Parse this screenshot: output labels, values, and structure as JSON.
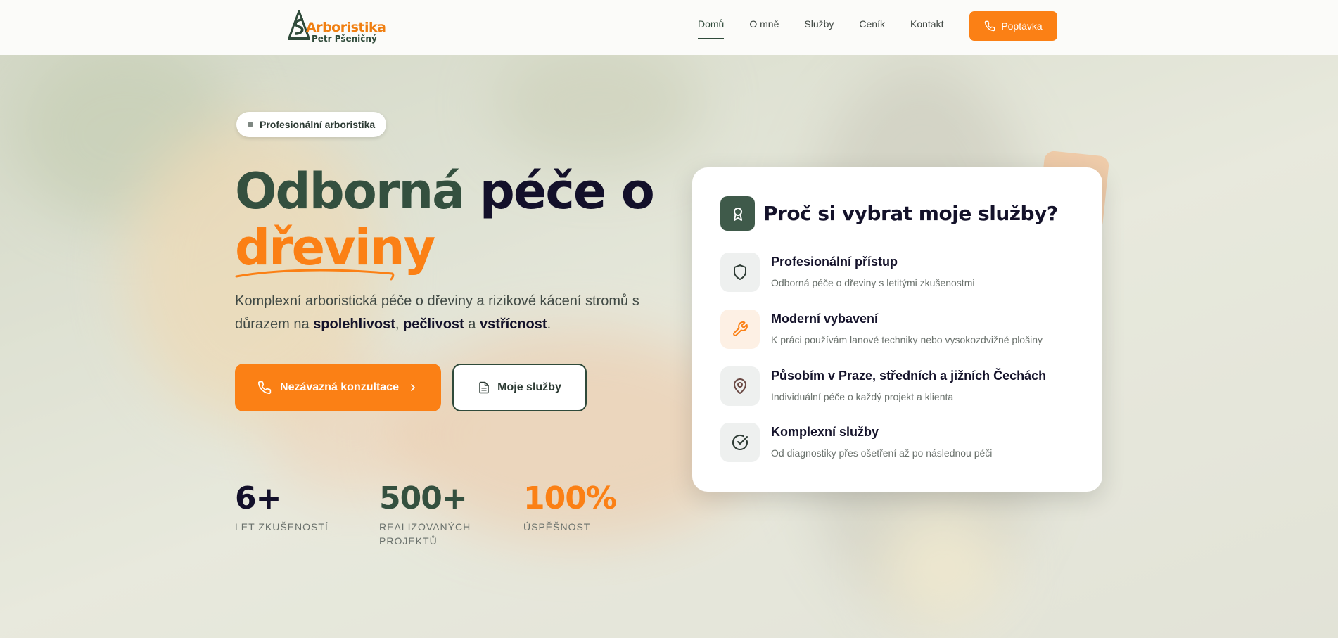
{
  "brand": {
    "title": "Arboristika",
    "subtitle": "Petr Pšeničný",
    "colors": {
      "primary": "#fb8015",
      "dark_green": "#2f4a3a",
      "navy": "#13102a"
    }
  },
  "nav": {
    "items": [
      {
        "label": "Domů",
        "active": true
      },
      {
        "label": "O mně",
        "active": false
      },
      {
        "label": "Služby",
        "active": false
      },
      {
        "label": "Ceník",
        "active": false
      },
      {
        "label": "Kontakt",
        "active": false
      }
    ],
    "cta_label": "Poptávka",
    "cta_icon": "phone-icon"
  },
  "hero": {
    "badge": "Profesionální arboristika",
    "title_part1": "Odborná",
    "title_part2": "péče o",
    "title_part3": "dřeviny",
    "lead_text": "Komplexní arboristická péče o dřeviny a rizikové kácení stromů s důrazem na",
    "lead_bold1": "spolehlivost",
    "lead_sep1": ",",
    "lead_bold2": "pečlivost",
    "lead_sep2": "a",
    "lead_bold3": "vstřícnost",
    "lead_end": ".",
    "primary_button": {
      "label": "Nezávazná konzultace",
      "icon": "phone-icon",
      "trailing_icon": "chevron-right-icon"
    },
    "secondary_button": {
      "label": "Moje služby",
      "icon": "document-icon"
    }
  },
  "stats": [
    {
      "value": "6+",
      "label": "LET ZKUŠENOSTÍ",
      "color": "#13102a"
    },
    {
      "value": "500+",
      "label_line1": "REALIZOVANÝCH",
      "label_line2": "PROJEKTŮ",
      "color": "#34503f"
    },
    {
      "value": "100%",
      "label": "ÚSPĚŠNOST",
      "color": "#fb8015"
    }
  ],
  "card": {
    "title": "Proč si vybrat moje služby?",
    "title_icon": "award-icon",
    "features": [
      {
        "title": "Profesionální přístup",
        "desc": "Odborná péče o dřeviny s letitými zkušenostmi",
        "icon": "shield-icon"
      },
      {
        "title": "Moderní vybavení",
        "desc": "K práci používám lanové techniky nebo vysokozdvižné plošiny",
        "icon": "wrench-icon"
      },
      {
        "title": "Působím v Praze, středních a jižních Čechách",
        "desc": "Individuální péče o každý projekt a klienta",
        "icon": "map-pin-icon"
      },
      {
        "title": "Komplexní služby",
        "desc": "Od diagnostiky přes ošetření až po následnou péči",
        "icon": "check-circle-icon"
      }
    ]
  }
}
